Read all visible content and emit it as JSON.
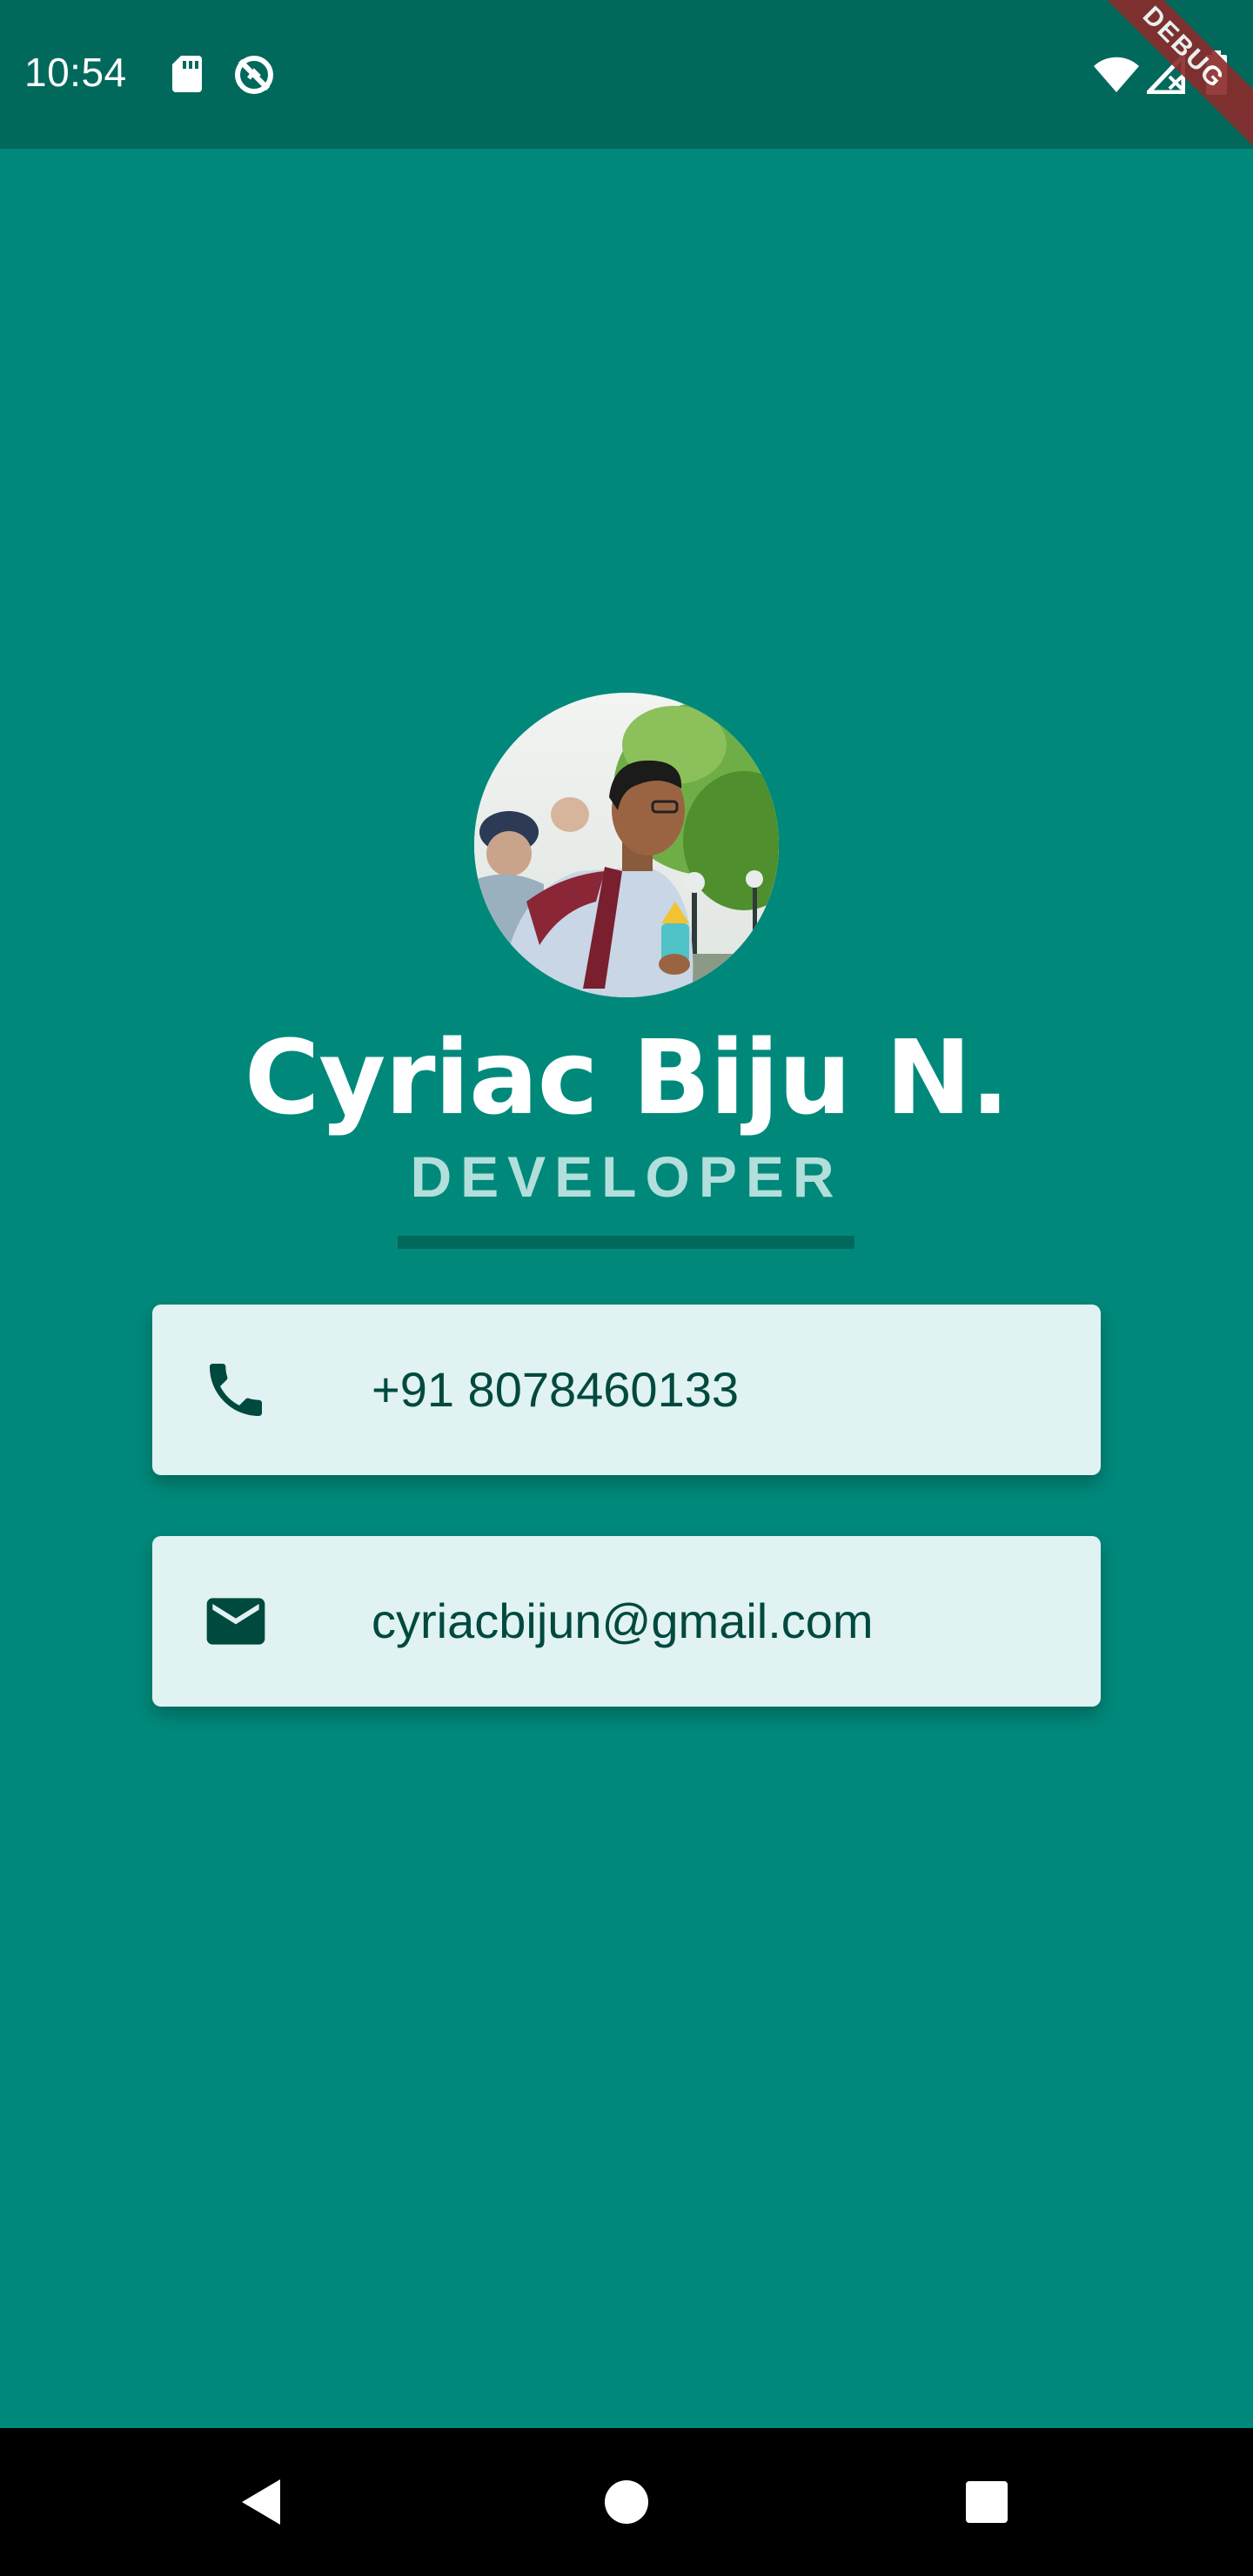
{
  "status_bar": {
    "time": "10:54",
    "icons": [
      "sd-card-icon",
      "sync-disabled-icon",
      "wifi-icon",
      "no-signal-icon",
      "battery-icon"
    ],
    "debug_label": "DEBUG"
  },
  "profile": {
    "name": "Cyriac Biju N.",
    "title": "DEVELOPER",
    "avatar": "profile-photo"
  },
  "contacts": [
    {
      "icon": "phone-icon",
      "text": "+91 8078460133"
    },
    {
      "icon": "mail-icon",
      "text": "cyriacbijun@gmail.com"
    }
  ],
  "nav_bar": {
    "buttons": [
      "back-icon",
      "home-icon",
      "recents-icon"
    ]
  },
  "colors": {
    "background": "#00897b",
    "status_bar": "#00695c",
    "card": "#e0f2f1",
    "card_text": "#00493f",
    "subtitle": "#b2dfdb"
  }
}
